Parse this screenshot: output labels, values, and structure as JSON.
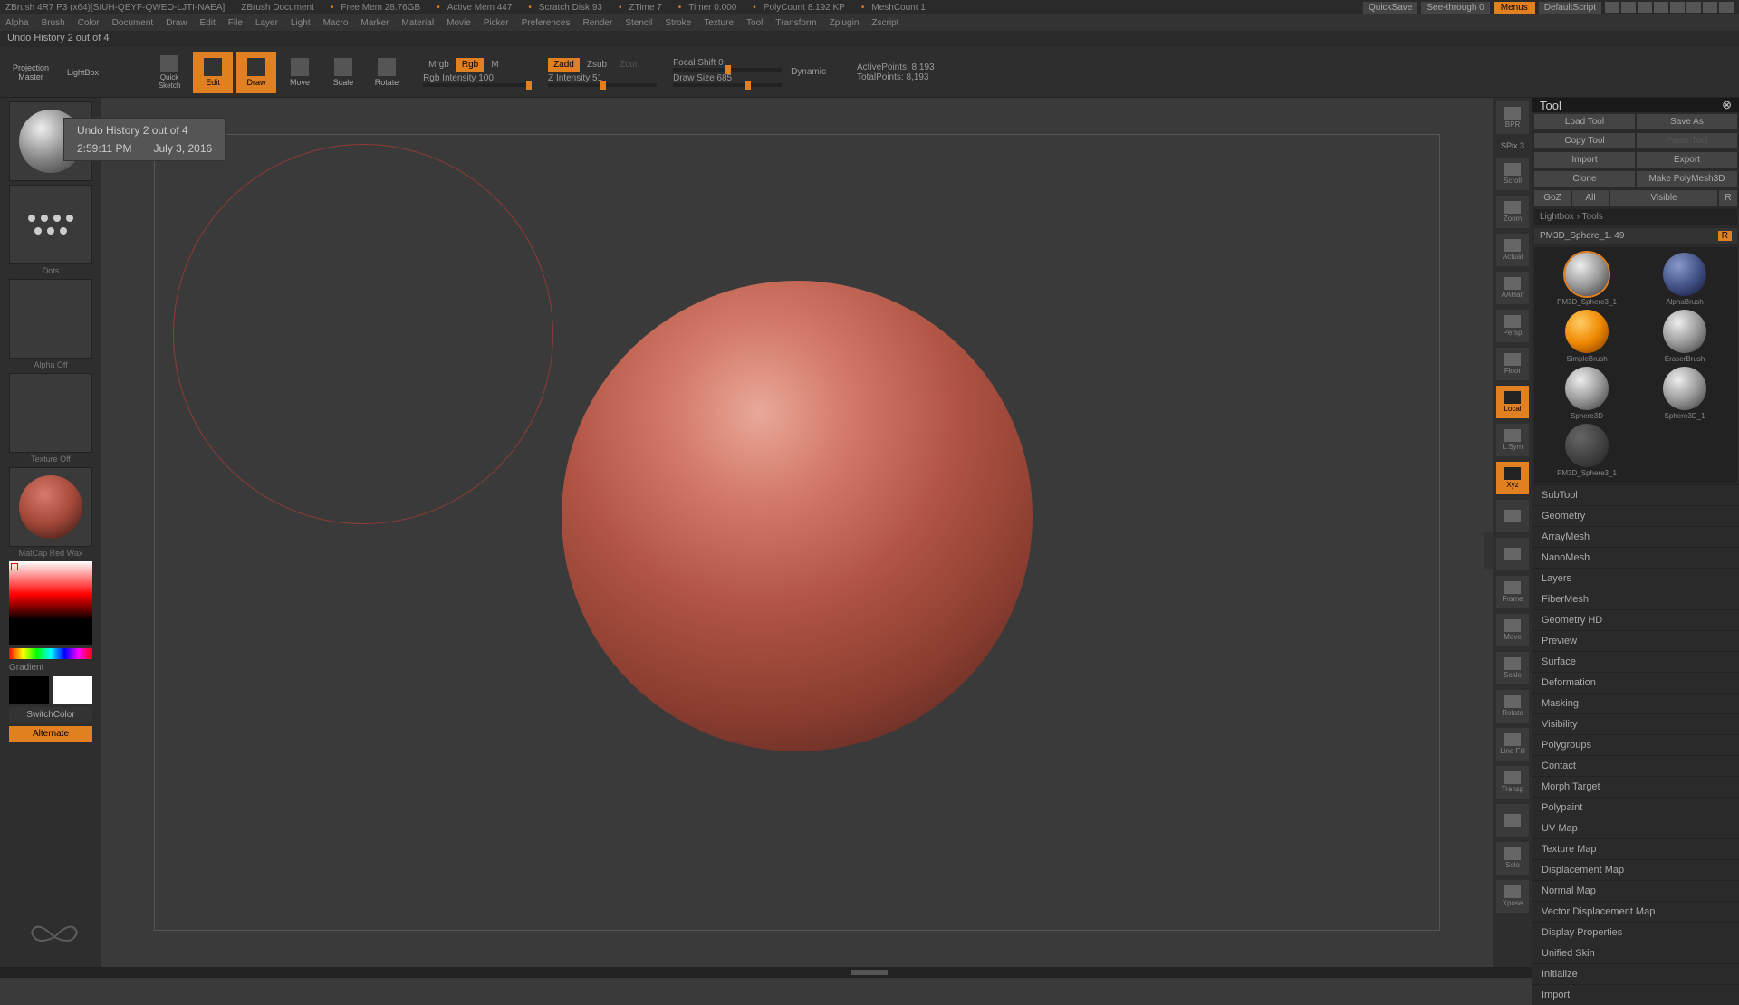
{
  "titlebar": {
    "app": "ZBrush 4R7 P3 (x64)[SIUH-QEYF-QWEO-LJTI-NAEA]",
    "doc": "ZBrush Document",
    "freemem": "Free Mem 28.76GB",
    "activemem": "Active Mem 447",
    "scratch": "Scratch Disk 93",
    "ztime": "ZTime 7",
    "timer": "Timer 0.000",
    "polycount": "PolyCount 8.192 KP",
    "meshcount": "MeshCount 1",
    "quicksave": "QuickSave",
    "seethrough": "See-through  0",
    "menus": "Menus",
    "script": "DefaultScript"
  },
  "menu": [
    "Alpha",
    "Brush",
    "Color",
    "Document",
    "Draw",
    "Edit",
    "File",
    "Layer",
    "Light",
    "Macro",
    "Marker",
    "Material",
    "Movie",
    "Picker",
    "Preferences",
    "Render",
    "Stencil",
    "Stroke",
    "Texture",
    "Tool",
    "Transform",
    "Zplugin",
    "Zscript"
  ],
  "status": "Undo History 2 out of 4",
  "toolbar": {
    "projection": "Projection\nMaster",
    "lightbox": "LightBox",
    "quicksketch": "Quick\nSketch",
    "edit": "Edit",
    "draw": "Draw",
    "move": "Move",
    "scale": "Scale",
    "rotate": "Rotate",
    "mrgb": "Mrgb",
    "rgb": "Rgb",
    "m": "M",
    "rgbint": "Rgb Intensity 100",
    "zadd": "Zadd",
    "zsub": "Zsub",
    "zcut": "Zcut",
    "zint": "Z Intensity 51",
    "focal": "Focal Shift 0",
    "drawsize": "Draw Size 685",
    "dynamic": "Dynamic",
    "activepts": "ActivePoints: 8,193",
    "totalpts": "TotalPoints: 8,193"
  },
  "tooltip": {
    "line1": "Undo History 2 out of 4",
    "time": "2:59:11 PM",
    "date": "July 3, 2016"
  },
  "left": {
    "brush": "",
    "stroke": "Dots",
    "alpha": "Alpha Off",
    "texture": "Texture Off",
    "material": "MatCap Red Wax",
    "gradient": "Gradient",
    "switchcolor": "SwitchColor",
    "alternate": "Alternate"
  },
  "righticons": [
    "BPR",
    "Scroll",
    "Zoom",
    "Actual",
    "AAHalf",
    "Persp",
    "Floor",
    "Local",
    "L.Sym",
    "Xyz",
    "",
    "",
    "Frame",
    "Move",
    "Scale",
    "Rotate",
    "Line Fill",
    "Transp",
    "",
    "Solo",
    "Xpose"
  ],
  "righticons_small": "SPix 3",
  "tool": {
    "title": "Tool",
    "loadtool": "Load Tool",
    "saveas": "Save As",
    "copytool": "Copy Tool",
    "pastetool": "Paste Tool",
    "import": "Import",
    "export": "Export",
    "clone": "Clone",
    "makepoly": "Make PolyMesh3D",
    "goz": "GoZ",
    "all": "All",
    "visible": "Visible",
    "r": "R",
    "lightbox": "Lightbox › Tools",
    "toolname": "PM3D_Sphere_1. 49",
    "tools": [
      {
        "label": "PM3D_Sphere3_1",
        "sel": true
      },
      {
        "label": "AlphaBrush"
      },
      {
        "label": "SimpleBrush"
      },
      {
        "label": "EraserBrush"
      },
      {
        "label": "Sphere3D"
      },
      {
        "label": "Sphere3D_1"
      },
      {
        "label": "PM3D_Sphere3_1"
      }
    ],
    "sections": [
      "SubTool",
      "Geometry",
      "ArrayMesh",
      "NanoMesh",
      "Layers",
      "FiberMesh",
      "Geometry HD",
      "Preview",
      "Surface",
      "Deformation",
      "Masking",
      "Visibility",
      "Polygroups",
      "Contact",
      "Morph Target",
      "Polypaint",
      "UV Map",
      "Texture Map",
      "Displacement Map",
      "Normal Map",
      "Vector Displacement Map",
      "Display Properties",
      "Unified Skin",
      "Initialize",
      "Import"
    ]
  }
}
